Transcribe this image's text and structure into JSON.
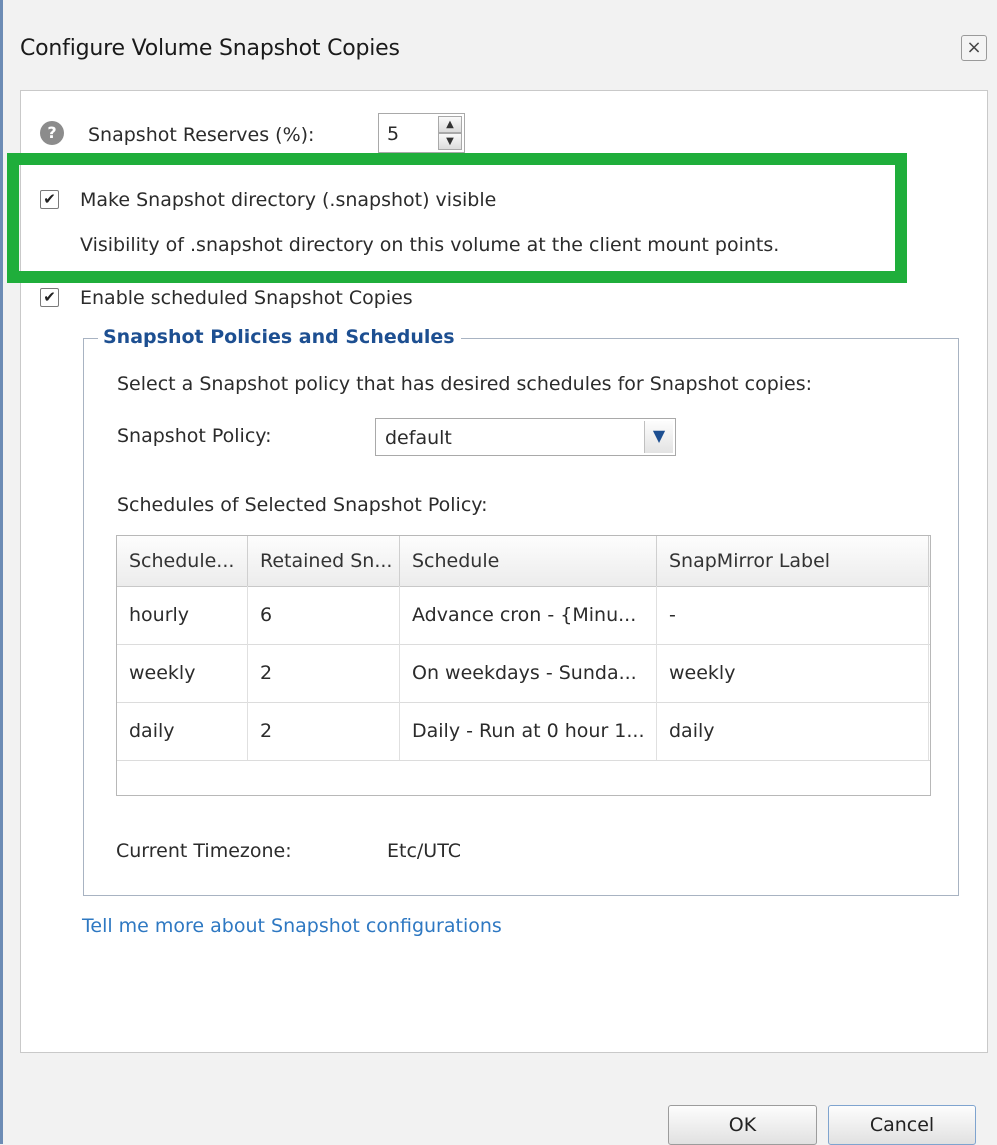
{
  "dialog": {
    "title": "Configure Volume Snapshot Copies",
    "close_label": "×"
  },
  "snapshot_reserve": {
    "label": "Snapshot Reserves (%):",
    "value": "5"
  },
  "snapshot_dir": {
    "label": "Make Snapshot directory (.snapshot) visible",
    "description": "Visibility of .snapshot directory on this volume at the client mount points.",
    "checked": true
  },
  "scheduled": {
    "label": "Enable scheduled Snapshot Copies",
    "checked": true
  },
  "policies": {
    "legend": "Snapshot Policies and Schedules",
    "instruction": "Select a Snapshot policy that has desired schedules for Snapshot copies:",
    "policy_label": "Snapshot Policy:",
    "policy_value": "default",
    "schedules_label": "Schedules of Selected Snapshot Policy:",
    "table": {
      "headers": [
        "Schedule...",
        "Retained Sn...",
        "Schedule",
        "SnapMirror Label"
      ],
      "rows": [
        [
          "hourly",
          "6",
          "Advance cron - {Minu...",
          "-"
        ],
        [
          "weekly",
          "2",
          "On weekdays - Sunda...",
          "weekly"
        ],
        [
          "daily",
          "2",
          "Daily - Run at 0 hour 1...",
          "daily"
        ]
      ]
    },
    "timezone_label": "Current Timezone:",
    "timezone_value": "Etc/UTC"
  },
  "help_link": "Tell me more about Snapshot configurations",
  "buttons": {
    "ok": "OK",
    "cancel": "Cancel"
  },
  "colors": {
    "highlight": "#1fae3b",
    "legend_text": "#1d4f91",
    "link": "#2e78c2"
  }
}
